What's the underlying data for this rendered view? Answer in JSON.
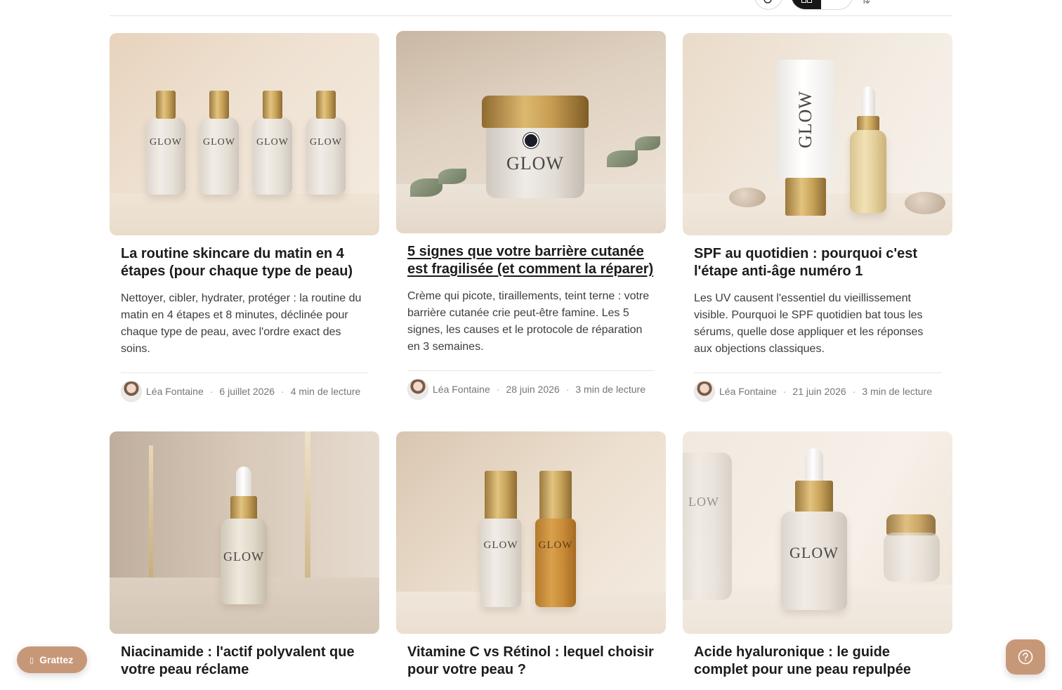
{
  "toolbar": {
    "search_icon": "search-icon",
    "view_grid_icon": "grid-view-icon",
    "view_list_icon": "list-view-icon",
    "sort_icon": "sort-icon"
  },
  "articles": [
    {
      "title": "La routine skincare du matin en 4 étapes (pour chaque type de peau)",
      "excerpt": "Nettoyer, cibler, hydrater, protéger : la routine du matin en 4 étapes et 8 minutes, déclinée pour chaque type de peau, avec l'ordre exact des soins.",
      "author": "Léa Fontaine",
      "date": "6 juillet 2026",
      "read_time": "4 min de lecture",
      "image_label": "GLOW"
    },
    {
      "title": "5 signes que votre barrière cutanée est fragilisée (et comment la réparer)",
      "excerpt": "Crème qui picote, tiraillements, teint terne : votre barrière cutanée crie peut-être famine. Les 5 signes, les causes et le protocole de réparation en 3 semaines.",
      "author": "Léa Fontaine",
      "date": "28 juin 2026",
      "read_time": "3 min de lecture",
      "image_label": "GLOW"
    },
    {
      "title": "SPF au quotidien : pourquoi c'est l'étape anti-âge numéro 1",
      "excerpt": "Les UV causent l'essentiel du vieillissement visible. Pourquoi le SPF quotidien bat tous les sérums, quelle dose appliquer et les réponses aux objections classiques.",
      "author": "Léa Fontaine",
      "date": "21 juin 2026",
      "read_time": "3 min de lecture",
      "image_label": "GLOW"
    },
    {
      "title": "Niacinamide : l'actif polyvalent que votre peau réclame",
      "image_label": "GLOW"
    },
    {
      "title": "Vitamine C vs Rétinol : lequel choisir pour votre peau ?",
      "image_label": "GLOW"
    },
    {
      "title": "Acide hyaluronique : le guide complet pour une peau repulpée",
      "image_label": "GLOW",
      "image_label_partial": "LOW"
    }
  ],
  "separator": "·",
  "floating": {
    "grattez_label": "Grattez",
    "grattez_icon": "gift-icon",
    "help_icon": "help-icon",
    "accent_color": "#c79878"
  }
}
